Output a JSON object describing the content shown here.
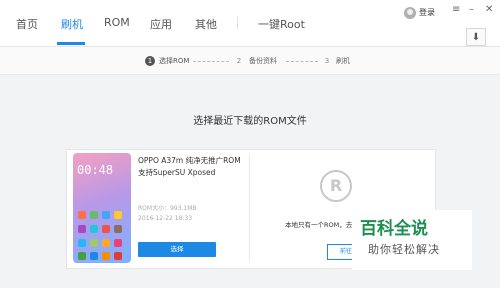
{
  "nav": {
    "items": [
      {
        "label": "首页",
        "active": false
      },
      {
        "label": "刷机",
        "active": true
      },
      {
        "label": "ROM",
        "active": false
      },
      {
        "label": "应用",
        "active": false
      },
      {
        "label": "其他",
        "active": false
      },
      {
        "label": "一键Root",
        "active": false
      }
    ]
  },
  "header": {
    "login_label": "登录",
    "icons": [
      "user-avatar-icon",
      "menu-icon",
      "minimize-icon",
      "close-icon",
      "download-icon"
    ]
  },
  "steps": [
    {
      "number": "1",
      "label": "选择ROM",
      "active": true
    },
    {
      "number": "2",
      "label": "备份资料",
      "active": false
    },
    {
      "number": "3",
      "label": "刷机",
      "active": false
    }
  ],
  "main": {
    "heading": "选择最近下载的ROM文件"
  },
  "rom": {
    "title_line1": "OPPO A37m 纯净无推广ROM",
    "title_line2": "支持SuperSU Xposed",
    "size": "ROM大小：993.1MB",
    "date": "2016-12-22  18:33",
    "select_label": "选择",
    "phone_time": "00:48"
  },
  "local": {
    "message": "本地只有一个ROM，去",
    "goto_label": "前往下载"
  },
  "watermark": {
    "title": "百科全说",
    "subtitle": "助你轻松解决"
  },
  "colors": {
    "accent": "#1e88e5",
    "watermark_green": "#1d8f4e"
  }
}
